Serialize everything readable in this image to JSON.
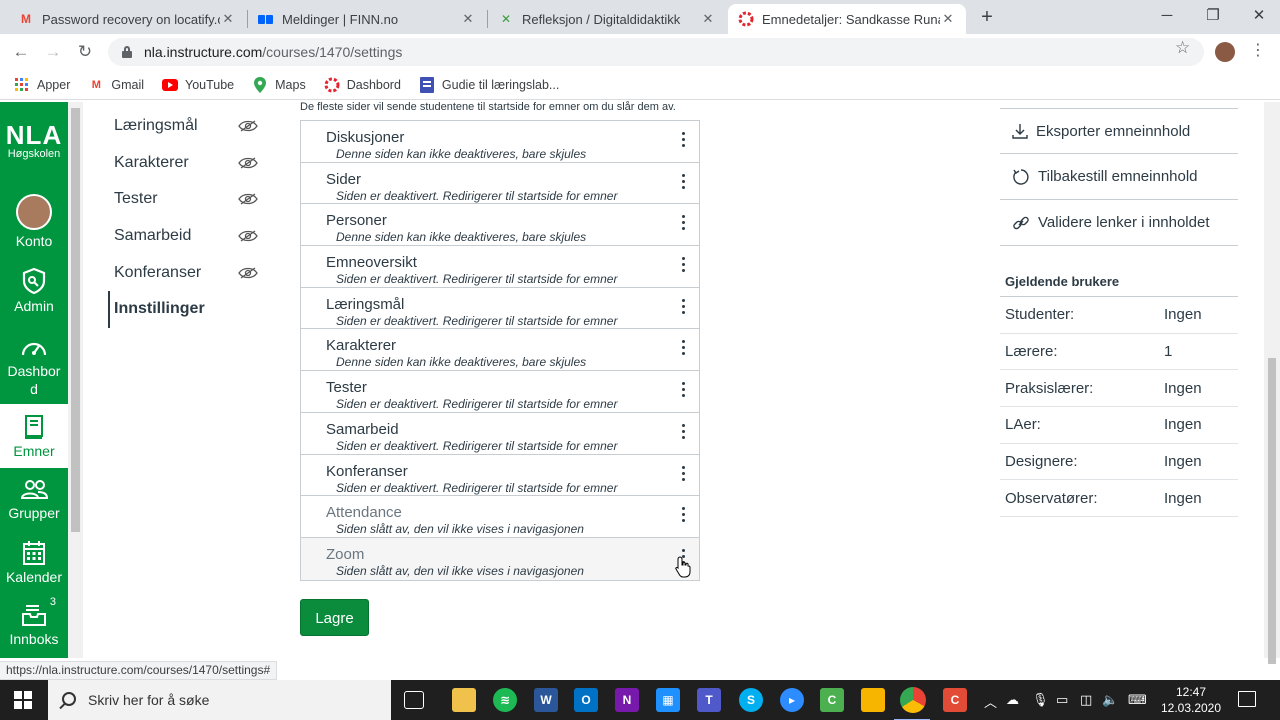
{
  "browser": {
    "tabs": [
      {
        "title": "Password recovery on locatify.co",
        "icon": "gmail-icon",
        "color": "#ea4335",
        "active": false
      },
      {
        "title": "Meldinger | FINN.no",
        "icon": "finn-icon",
        "color": "#0063fb",
        "active": false
      },
      {
        "title": "Refleksjon / Digitaldidaktikk",
        "icon": "pbworks-icon",
        "color": "#3b9c3b",
        "active": false
      },
      {
        "title": "Emnedetaljer: Sandkasse Runar E",
        "icon": "canvas-icon",
        "color": "#e4252d",
        "active": true
      }
    ],
    "url_host": "nla.instructure.com",
    "url_path": "/courses/1470/settings",
    "bookmarks": [
      {
        "label": "Apper",
        "icon": "apps-grid-icon"
      },
      {
        "label": "Gmail",
        "icon": "gmail-icon"
      },
      {
        "label": "YouTube",
        "icon": "youtube-icon"
      },
      {
        "label": "Maps",
        "icon": "maps-pin-icon"
      },
      {
        "label": "Dashbord",
        "icon": "canvas-icon"
      },
      {
        "label": "Gudie til læringslab...",
        "icon": "forms-icon"
      }
    ],
    "status_url": "https://nla.instructure.com/courses/1470/settings#"
  },
  "global_nav": {
    "logo_big": "NLA",
    "logo_small": "Høgskolen",
    "items": [
      {
        "label": "Konto",
        "icon": "avatar"
      },
      {
        "label": "Admin",
        "icon": "shield-icon"
      },
      {
        "label": "Dashbord",
        "icon": "dashboard-icon"
      },
      {
        "label": "Emner",
        "icon": "book-icon",
        "active": true
      },
      {
        "label": "Grupper",
        "icon": "groups-icon"
      },
      {
        "label": "Kalender",
        "icon": "calendar-icon"
      },
      {
        "label": "Innboks",
        "icon": "inbox-icon",
        "badge": "3"
      }
    ]
  },
  "course_nav": {
    "items": [
      {
        "label": "Læringsmål",
        "hidden": true
      },
      {
        "label": "Karakterer",
        "hidden": true
      },
      {
        "label": "Tester",
        "hidden": true
      },
      {
        "label": "Samarbeid",
        "hidden": true
      },
      {
        "label": "Konferanser",
        "hidden": true
      },
      {
        "label": "Innstillinger",
        "active": true
      }
    ]
  },
  "main": {
    "intro": "De fleste sider vil sende studentene til startside for emner om du slår dem av.",
    "nav_items": [
      {
        "label": "Diskusjoner",
        "note": "Denne siden kan ikke deaktiveres, bare skjules"
      },
      {
        "label": "Sider",
        "note": "Siden er deaktivert. Redirigerer til startside for emner"
      },
      {
        "label": "Personer",
        "note": "Denne siden kan ikke deaktiveres, bare skjules"
      },
      {
        "label": "Emneoversikt",
        "note": "Siden er deaktivert. Redirigerer til startside for emner"
      },
      {
        "label": "Læringsmål",
        "note": "Siden er deaktivert. Redirigerer til startside for emner"
      },
      {
        "label": "Karakterer",
        "note": "Denne siden kan ikke deaktiveres, bare skjules"
      },
      {
        "label": "Tester",
        "note": "Siden er deaktivert. Redirigerer til startside for emner"
      },
      {
        "label": "Samarbeid",
        "note": "Siden er deaktivert. Redirigerer til startside for emner"
      },
      {
        "label": "Konferanser",
        "note": "Siden er deaktivert. Redirigerer til startside for emner"
      },
      {
        "label": "Attendance",
        "note": "Siden slått av, den vil ikke vises i navigasjonen"
      },
      {
        "label": "Zoom",
        "note": "Siden slått av, den vil ikke vises i navigasjonen",
        "highlight": true
      }
    ],
    "save_label": "Lagre"
  },
  "sidebar": {
    "buttons": [
      {
        "label": "Eksporter emneinnhold",
        "icon": "download-icon"
      },
      {
        "label": "Tilbakestill emneinnhold",
        "icon": "reset-icon"
      },
      {
        "label": "Validere lenker i innholdet",
        "icon": "link-icon"
      }
    ],
    "users_title": "Gjeldende brukere",
    "users": [
      {
        "role": "Studenter:",
        "value": "Ingen"
      },
      {
        "role": "Lærere:",
        "value": "1"
      },
      {
        "role": "Praksislærer:",
        "value": "Ingen"
      },
      {
        "role": "LAer:",
        "value": "Ingen"
      },
      {
        "role": "Designere:",
        "value": "Ingen"
      },
      {
        "role": "Observatører:",
        "value": "Ingen"
      }
    ]
  },
  "taskbar": {
    "search_placeholder": "Skriv her for å søke",
    "time": "12:47",
    "date": "12.03.2020"
  }
}
